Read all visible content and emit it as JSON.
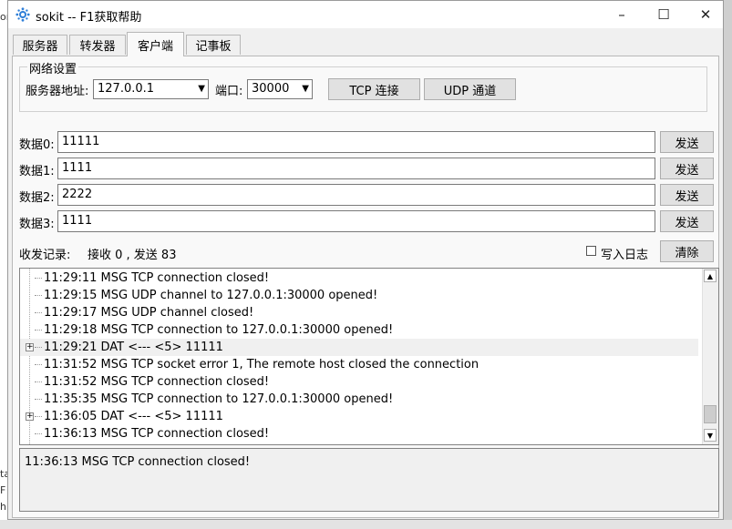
{
  "window": {
    "title": "sokit -- F1获取帮助",
    "controls": {
      "minimize": "–",
      "maximize": "☐",
      "close": "✕"
    }
  },
  "background": {
    "fragments": [
      "or",
      "ta",
      "F",
      "h"
    ]
  },
  "tabs": [
    {
      "label": "服务器",
      "active": false
    },
    {
      "label": "转发器",
      "active": false
    },
    {
      "label": "客户端",
      "active": true
    },
    {
      "label": "记事板",
      "active": false
    }
  ],
  "network": {
    "legend": "网络设置",
    "server_label": "服务器地址:",
    "server_value": "127.0.0.1",
    "port_label": "端口:",
    "port_value": "30000",
    "tcp_button": "TCP 连接",
    "udp_button": "UDP 通道"
  },
  "data_rows": [
    {
      "label": "数据0:",
      "value": "11111",
      "send": "发送"
    },
    {
      "label": "数据1:",
      "value": "1111",
      "send": "发送"
    },
    {
      "label": "数据2:",
      "value": "2222",
      "send": "发送"
    },
    {
      "label": "数据3:",
      "value": "1111",
      "send": "发送"
    }
  ],
  "records": {
    "label": "收发记录:",
    "stats": "接收 0 , 发送 83",
    "write_log": "写入日志",
    "clear": "清除"
  },
  "log": [
    {
      "text": "11:29:11 MSG TCP connection closed!",
      "expandable": false,
      "highlight": false
    },
    {
      "text": "11:29:15 MSG UDP channel to 127.0.0.1:30000 opened!",
      "expandable": false,
      "highlight": false
    },
    {
      "text": "11:29:17 MSG UDP channel closed!",
      "expandable": false,
      "highlight": false
    },
    {
      "text": "11:29:18 MSG TCP connection to 127.0.0.1:30000 opened!",
      "expandable": false,
      "highlight": false
    },
    {
      "text": "11:29:21 DAT <--- <5> 11111",
      "expandable": true,
      "highlight": true
    },
    {
      "text": "11:31:52 MSG TCP socket error 1, The remote host closed the connection",
      "expandable": false,
      "highlight": false
    },
    {
      "text": "11:31:52 MSG TCP connection closed!",
      "expandable": false,
      "highlight": false
    },
    {
      "text": "11:35:35 MSG TCP connection to 127.0.0.1:30000 opened!",
      "expandable": false,
      "highlight": false
    },
    {
      "text": "11:36:05 DAT <--- <5> 11111",
      "expandable": true,
      "highlight": false
    },
    {
      "text": "11:36:13 MSG TCP connection closed!",
      "expandable": false,
      "highlight": false
    }
  ],
  "detail": {
    "text": "11:36:13 MSG TCP connection closed!"
  },
  "colors": {
    "accent": "#2f7fd8",
    "window_bg": "#f0f0f0",
    "panel_bg": "#f9f9f9"
  }
}
